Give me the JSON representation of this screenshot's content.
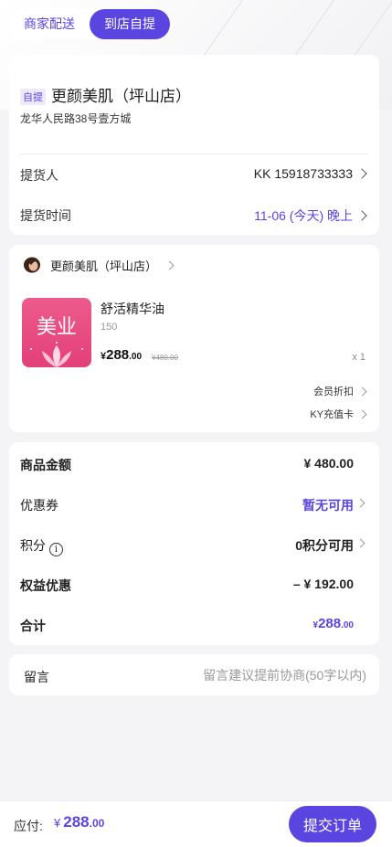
{
  "colors": {
    "accent": "#5b45e0",
    "background": "#f4f4f6"
  },
  "mode_tabs": {
    "delivery": "商家配送",
    "pickup": "到店自提",
    "active": "pickup"
  },
  "store": {
    "tag": "自提",
    "name": "更颜美肌（坪山店）",
    "address": "龙华人民路38号壹方城",
    "pickup_person_label": "提货人",
    "pickup_person_value": "KK 15918733333",
    "pickup_time_label": "提货时间",
    "pickup_time_value": "11-06 (今天) 晚上"
  },
  "product_card": {
    "shop_name": "更颜美肌（坪山店）",
    "shop_logo_icon": "woman-avatar-icon",
    "thumbnail_text": "美业",
    "product_name": "舒活精华油",
    "spec": "150",
    "price_yen": "¥",
    "price_main": "288",
    "price_cents": ".00",
    "original_price": "¥480.00",
    "quantity": "x 1",
    "member_discount": "会员折扣",
    "stored_value_card": "KY充值卡"
  },
  "summary": {
    "goods_amount_label": "商品金额",
    "goods_amount_value": "¥ 480.00",
    "coupon_label": "优惠券",
    "coupon_value": "暂无可用",
    "points_label": "积分",
    "points_value": "0积分可用",
    "rights_label": "权益优惠",
    "rights_value": "– ¥ 192.00",
    "total_label": "合计",
    "total_yen": "¥",
    "total_main": "288",
    "total_cents": ".00"
  },
  "remark": {
    "label": "留言",
    "placeholder": "留言建议提前协商(50字以内)"
  },
  "bottom_bar": {
    "pay_label": "应付:",
    "pay_yen": "¥",
    "pay_main": "288",
    "pay_cents": ".00",
    "submit_label": "提交订单"
  }
}
